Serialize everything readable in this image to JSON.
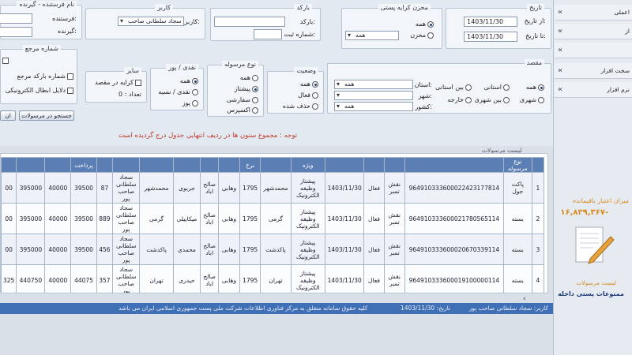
{
  "sidebar": {
    "items": [
      {
        "label": "اعملی"
      },
      {
        "label": "از"
      },
      {
        "label": ""
      },
      {
        "label": "سخت افزار"
      },
      {
        "label": "نرم افزار"
      }
    ],
    "credit_title": "میزان اعتبار باقیمانده",
    "credit_value": "۱۶,۸۳۹,۳۶۷-",
    "link_list": "لیست مرسولات",
    "prohibited": "ممنوعات پستی داخله"
  },
  "filters": {
    "date": {
      "legend": "تاریخ",
      "from_label": "از تاریخ:",
      "from_value": "1403/11/30",
      "to_label": "تا تاریخ:",
      "to_value": "1403/11/30"
    },
    "payment": {
      "legend": "محزن کرایه پستی",
      "opt_all": "همه",
      "opt_other": "محزن",
      "select": "همه"
    },
    "barcode": {
      "legend": "بارکد",
      "barcode_label": "بارکد:",
      "serial_label": "شماره ثبت:"
    },
    "user": {
      "legend": "کاربر",
      "user_label": "کاربر:",
      "user_value": "سجاد سلطانی صاحب"
    },
    "sender": {
      "legend": "نام فرستنده - گیرنده",
      "sender_label": "فرستنده:",
      "receiver_label": "گیرنده:"
    },
    "destination": {
      "legend": "مقصد",
      "opt_all": "همه",
      "opt_provincial": "استانی",
      "opt_interprovincial": "بین استانی",
      "opt_city": "شهری",
      "opt_intercity": "بین شهری",
      "opt_abroad": "خارجه",
      "province_label": "استان:",
      "province_value": "همه",
      "city_label": "شهر:",
      "city_value": "",
      "country_label": "کشور:",
      "country_value": "همه"
    },
    "status": {
      "legend": "وضعیت",
      "opt_all": "همه",
      "opt_active": "فعال",
      "opt_deleted": "حذف شده"
    },
    "type": {
      "legend": "نوع مرسوله",
      "opt_all": "همه",
      "opt_pishtaz": "پیشتاز",
      "opt_sefareshi": "سفارشی",
      "opt_express": "اکسپرس"
    },
    "cashpos": {
      "legend": "نقدی / پوز",
      "opt_all": "همه",
      "opt_cash": "نقدی / نسیه",
      "opt_pos": "پوز"
    },
    "other": {
      "legend": "سایر",
      "dest_fee": "کرایه در مقصد",
      "count_label": "تعداد : 0"
    },
    "reference": {
      "legend": "شماره مرجع",
      "opt1": "شماره بارکد مرجع",
      "opt2": "دلایل ابطال الکترونیکی"
    },
    "search_button": "جستجو در مرسولات",
    "clear_button": "ان"
  },
  "notice": "توجه : مجموع ستون ها در ردیف انتهایی جدول درج گردیده است",
  "table": {
    "title": "لیست مرسولات",
    "headers": [
      "",
      "نوع مرسوله",
      "",
      "",
      "",
      "",
      "ویژه",
      "",
      "نرخ",
      "",
      "",
      "",
      "",
      "",
      "",
      "پرداخت",
      "",
      "",
      ""
    ],
    "rows": [
      [
        "1",
        "پاکت جول",
        "964910333600022423177814",
        "نقش تمبر",
        "فعال",
        "1403/11/30",
        "پیشتاز وظیفه الکترونیک",
        "محمدشهر",
        "1795",
        "وهابی",
        "صالح اباد",
        "جریوی",
        "محمدشهر",
        "سجاد سلطانی صاحب پور",
        "87",
        "39500",
        "40000",
        "395000",
        "00"
      ],
      [
        "2",
        "بسته",
        "964910333600021780565114",
        "نقش تمبر",
        "فعال",
        "1403/11/30",
        "پیشتاز وظیفه الکترونیک",
        "گرمی",
        "1795",
        "وهابی",
        "صالح اباد",
        "میکاییلی",
        "گرمی",
        "سجاد سلطانی صاحب پور",
        "889",
        "39500",
        "40000",
        "395000",
        "00"
      ],
      [
        "3",
        "بسته",
        "964910333600020670339114",
        "نقش تمبر",
        "فعال",
        "1403/11/30",
        "پیشتاز وظیفه الکترونیک",
        "پاکدشت",
        "1795",
        "وهابی",
        "صالح اباد",
        "محمدی",
        "پاکدشت",
        "سجاد سلطانی صاحب پور",
        "456",
        "39500",
        "40000",
        "395000",
        "00"
      ],
      [
        "4",
        "بسته",
        "964910333600019100000114",
        "نقش تمبر",
        "فعال",
        "1403/11/30",
        "پیشتاز وظیفه الکترونیک",
        "تهران",
        "1795",
        "وهابی",
        "صالح اباد",
        "حیدری",
        "تهران",
        "سجاد سلطانی صاحب پور",
        "357",
        "44075",
        "40000",
        "440750",
        "325"
      ]
    ]
  },
  "status_bar": {
    "user": "کاربر: سجاد سلطانی صاحب پور",
    "date": "تاریخ: 1403/11/30",
    "copyright": "کلیه حقوق سامانه متعلق به مرکز فناوری اطلاعات شرکت ملی پست جمهوری اسلامی ایران می باشد"
  },
  "colors": {
    "header": "#5b7fb4",
    "footer": "#3f6fb5",
    "notice": "#c0392b",
    "accent_orange": "#d98a1a"
  }
}
